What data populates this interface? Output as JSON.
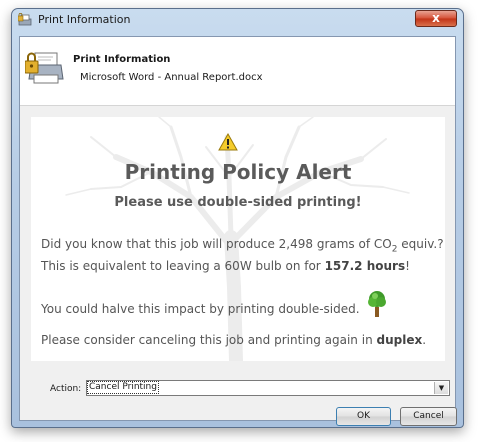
{
  "window": {
    "title": "Print Information"
  },
  "header": {
    "title": "Print Information",
    "document": "Microsoft Word - Annual Report.docx"
  },
  "alert": {
    "title": "Printing Policy Alert",
    "subtitle": "Please use double-sided printing!",
    "line1_prefix": "Did you know that this job will produce 2,498 grams of CO",
    "line1_subscript": "2",
    "line1_suffix": " equiv.?",
    "line2_prefix": "This is equivalent to leaving a 60W bulb on for ",
    "line2_bold": "157.2 hours",
    "line2_suffix": "!",
    "line3": "You could halve this impact by printing double-sided.",
    "line4_prefix": "Please consider canceling this job and printing again in ",
    "line4_bold": "duplex",
    "line4_suffix": "."
  },
  "action": {
    "label": "Action:",
    "selected": "Cancel Printing"
  },
  "buttons": {
    "ok": "OK",
    "cancel": "Cancel",
    "close": "x"
  },
  "colors": {
    "accent": "#c23418",
    "text": "#555555",
    "frame": "#b7cde6"
  },
  "icons": {
    "title": "printer-lock-icon",
    "header": "printer-lock-icon",
    "warning": "warning-triangle-icon",
    "tree": "tree-icon"
  }
}
